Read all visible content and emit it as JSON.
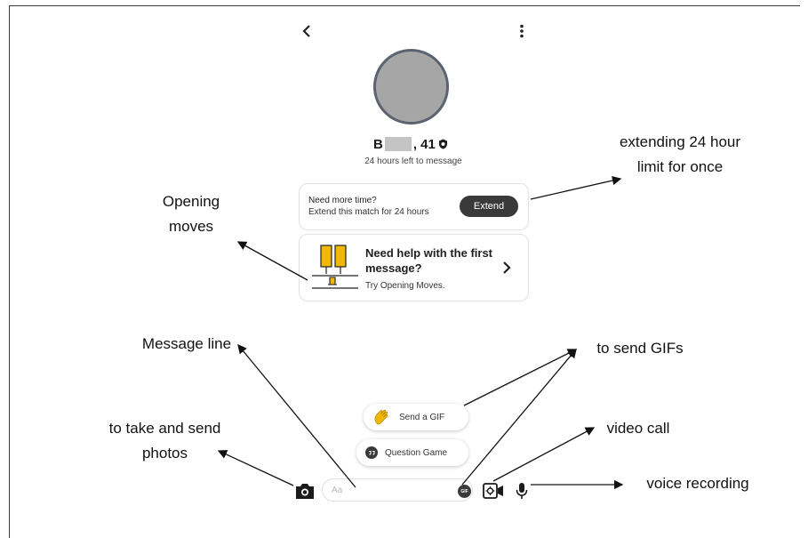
{
  "header": {
    "back_icon": "chevron-left-icon",
    "more_icon": "more-vert-icon"
  },
  "profile": {
    "name_initial": "B",
    "age": ", 41",
    "time_left": "24 hours left to message"
  },
  "extend_card": {
    "title": "Need more time?",
    "subtitle": "Extend this match for 24 hours",
    "button_label": "Extend"
  },
  "moves_card": {
    "title": "Need help with the first message?",
    "subtitle": "Try Opening Moves."
  },
  "chips": {
    "gif_label": "Send a GIF",
    "question_label": "Question Game"
  },
  "composer": {
    "placeholder": "Aa",
    "gif_badge": "GIF"
  },
  "annotations": {
    "opening_moves": "Opening moves",
    "extending": "extending 24 hour limit for once",
    "message_line": "Message line",
    "send_gifs": "to send GIFs",
    "take_photos": "to take and send photos",
    "video_call": "video call",
    "voice_recording": "voice recording"
  },
  "colors": {
    "dark_button": "#3a3a3a",
    "accent_yellow": "#f2b705"
  }
}
